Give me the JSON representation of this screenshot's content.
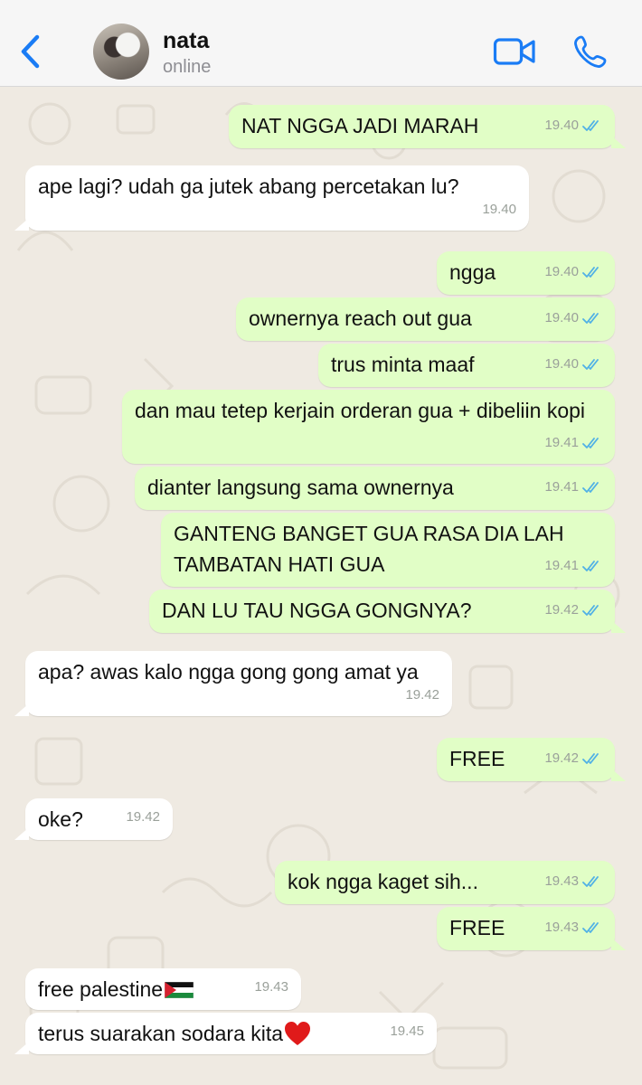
{
  "header": {
    "contact_name": "nata",
    "status": "online"
  },
  "colors": {
    "accent": "#1a7cf5",
    "outgoing_bubble": "#e1fec6",
    "incoming_bubble": "#ffffff",
    "read_ticks": "#4fb0e6",
    "chat_background": "#efeae2"
  },
  "messages": [
    {
      "dir": "out",
      "text": "NAT NGGA JADI MARAH",
      "time": "19.40",
      "ticks": "read"
    },
    {
      "dir": "in",
      "text": "ape lagi? udah ga jutek abang percetakan lu?",
      "time": "19.40"
    },
    {
      "dir": "out",
      "text": "ngga",
      "time": "19.40",
      "ticks": "read"
    },
    {
      "dir": "out",
      "text": "ownernya reach out gua",
      "time": "19.40",
      "ticks": "read"
    },
    {
      "dir": "out",
      "text": "trus minta maaf",
      "time": "19.40",
      "ticks": "read"
    },
    {
      "dir": "out",
      "text": "dan mau tetep kerjain orderan gua + dibeliin kopi",
      "time": "19.41",
      "ticks": "read"
    },
    {
      "dir": "out",
      "text": "dianter langsung sama ownernya",
      "time": "19.41",
      "ticks": "read"
    },
    {
      "dir": "out",
      "text": "GANTENG BANGET GUA RASA DIA LAH TAMBATAN HATI GUA",
      "time": "19.41",
      "ticks": "read"
    },
    {
      "dir": "out",
      "text": "DAN LU TAU NGGA GONGNYA?",
      "time": "19.42",
      "ticks": "read"
    },
    {
      "dir": "in",
      "text": "apa? awas kalo ngga gong gong amat ya",
      "time": "19.42"
    },
    {
      "dir": "out",
      "text": "FREE",
      "time": "19.42",
      "ticks": "read"
    },
    {
      "dir": "in",
      "text": "oke?",
      "time": "19.42"
    },
    {
      "dir": "out",
      "text": "kok ngga kaget sih...",
      "time": "19.43",
      "ticks": "read"
    },
    {
      "dir": "out",
      "text": "FREE",
      "time": "19.43",
      "ticks": "read"
    },
    {
      "dir": "in",
      "text": "free palestine",
      "emoji": "palestine-flag",
      "time": "19.43"
    },
    {
      "dir": "in",
      "text": "terus suarakan sodara kita",
      "emoji": "red-heart",
      "time": "19.45"
    }
  ]
}
